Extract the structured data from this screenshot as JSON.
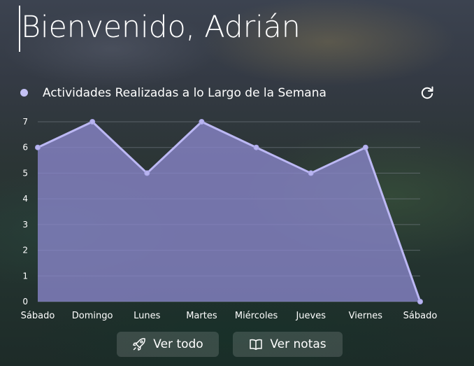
{
  "header": {
    "welcome_text": "Bienvenido, Adrián"
  },
  "chart_header": {
    "title": "Actividades Realizadas a lo Largo de la Semana",
    "refresh_icon": "refresh-icon"
  },
  "chart_data": {
    "type": "area",
    "title": "Actividades Realizadas a lo Largo de la Semana",
    "categories": [
      "Sábado",
      "Domingo",
      "Lunes",
      "Martes",
      "Miércoles",
      "Jueves",
      "Viernes",
      "Sábado"
    ],
    "series": [
      {
        "name": "Actividades Realizadas a lo Largo de la Semana",
        "values": [
          6,
          7,
          5,
          7,
          6,
          5,
          6,
          0
        ]
      }
    ],
    "yticks": [
      "0",
      "1",
      "2",
      "3",
      "4",
      "5",
      "6",
      "7"
    ],
    "ylim": [
      0,
      7
    ],
    "grid": true,
    "legend": "top-left",
    "colors": {
      "line": "#bcb8f4",
      "fill": "#8a86cc",
      "point": "#b8b4f0",
      "grid": "#7f8790"
    }
  },
  "actions": {
    "ver_todo_label": "Ver todo",
    "ver_todo_icon": "rocket-icon",
    "ver_notas_label": "Ver notas",
    "ver_notas_icon": "book-icon"
  }
}
